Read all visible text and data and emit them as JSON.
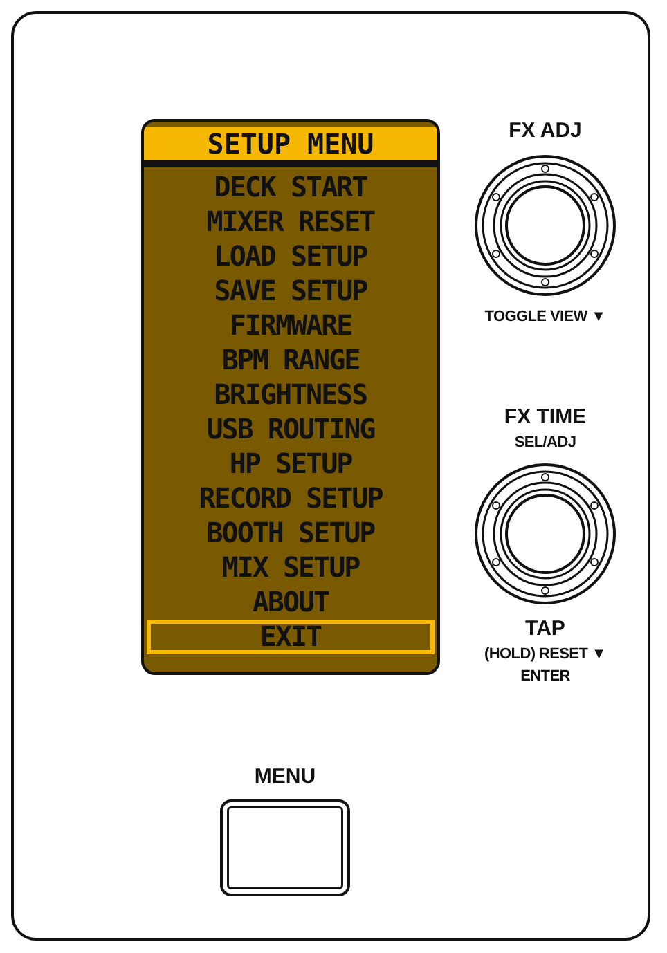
{
  "screen": {
    "title": "SETUP MENU",
    "items": [
      {
        "label": "DECK START",
        "selected": false
      },
      {
        "label": "MIXER RESET",
        "selected": false
      },
      {
        "label": "LOAD SETUP",
        "selected": false
      },
      {
        "label": "SAVE SETUP",
        "selected": false
      },
      {
        "label": "FIRMWARE",
        "selected": false
      },
      {
        "label": "BPM RANGE",
        "selected": false
      },
      {
        "label": "BRIGHTNESS",
        "selected": false
      },
      {
        "label": "USB ROUTING",
        "selected": false
      },
      {
        "label": "HP SETUP",
        "selected": false
      },
      {
        "label": "RECORD SETUP",
        "selected": false
      },
      {
        "label": "BOOTH SETUP",
        "selected": false
      },
      {
        "label": "MIX SETUP",
        "selected": false
      },
      {
        "label": "ABOUT",
        "selected": false
      },
      {
        "label": "EXIT",
        "selected": true
      }
    ]
  },
  "knobs": [
    {
      "labels": [
        "FX ADJ"
      ],
      "captions": [
        "TOGGLE VIEW ▼"
      ]
    },
    {
      "labels": [
        "FX TIME",
        "SEL/ADJ"
      ],
      "captions": [
        "TAP",
        "(HOLD) RESET ▼",
        "ENTER"
      ]
    }
  ],
  "menu_button": {
    "label": "MENU"
  }
}
